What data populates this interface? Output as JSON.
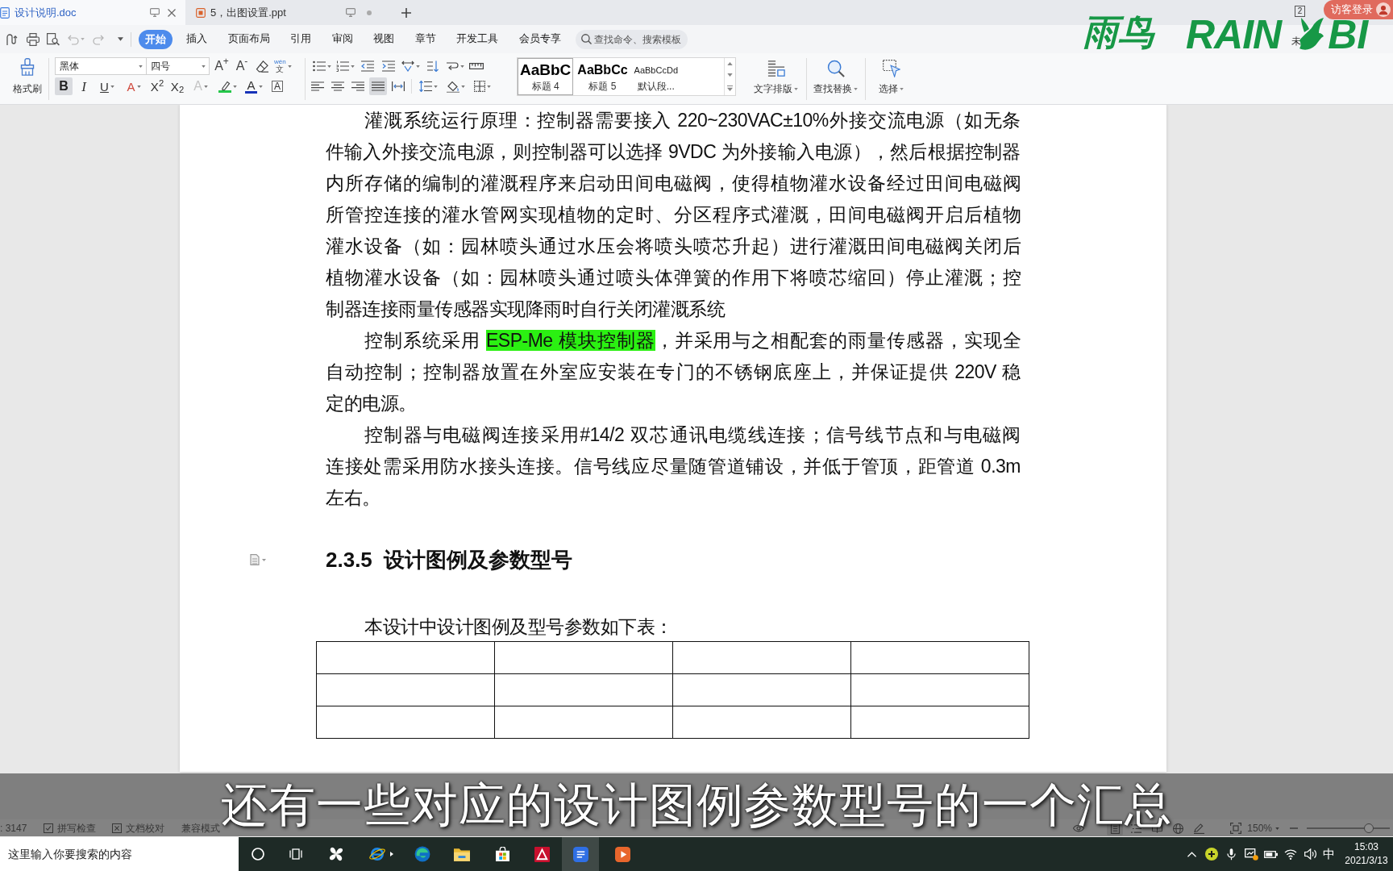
{
  "tabs": [
    {
      "label": "设计说明.doc",
      "kind": "doc",
      "selected": true
    },
    {
      "label": "5，出图设置.ppt",
      "kind": "ppt",
      "selected": false
    }
  ],
  "window_switcher": {
    "count": "2"
  },
  "login_button": {
    "label": "访客登录"
  },
  "menu_tabs": [
    {
      "label": "开始",
      "selected": true
    },
    {
      "label": "插入",
      "selected": false
    },
    {
      "label": "页面布局",
      "selected": false
    },
    {
      "label": "引用",
      "selected": false
    },
    {
      "label": "审阅",
      "selected": false
    },
    {
      "label": "视图",
      "selected": false
    },
    {
      "label": "章节",
      "selected": false
    },
    {
      "label": "开发工具",
      "selected": false
    },
    {
      "label": "会员专享",
      "selected": false
    }
  ],
  "command_search": {
    "placeholder": "查找命令、搜索模板"
  },
  "sync_status": "未",
  "toolbar": {
    "format_painter": {
      "label": "格式刷"
    },
    "font_name": "黑体",
    "font_size": "四号",
    "font_tools": [
      {
        "kind": "grow",
        "glyph": "A$^{+}$"
      },
      {
        "kind": "shrink",
        "glyph": "A$^{-}$"
      },
      {
        "kind": "clear"
      },
      {
        "kind": "pinyin",
        "glyph": "文",
        "ruby": "wén"
      }
    ],
    "format_buttons": [
      {
        "kind": "bold",
        "glyph": "B",
        "selected": true
      },
      {
        "kind": "italic",
        "glyph": "I",
        "selected": false
      },
      {
        "kind": "underline",
        "glyph": "U",
        "selected": false
      },
      {
        "kind": "strike",
        "glyph": "A",
        "selected": false
      },
      {
        "kind": "superscript",
        "glyph": "X$^{2}$",
        "selected": false
      },
      {
        "kind": "subscript",
        "glyph": "X$_{2}$",
        "selected": false
      },
      {
        "kind": "effects",
        "glyph": "A",
        "selected": false
      },
      {
        "kind": "highlight",
        "selected": false
      },
      {
        "kind": "font-color",
        "glyph": "A",
        "selected": false
      },
      {
        "kind": "char-border",
        "glyph": "A",
        "selected": false
      }
    ],
    "align_buttons": [
      {
        "kind": "left",
        "selected": false
      },
      {
        "kind": "center",
        "selected": false
      },
      {
        "kind": "right",
        "selected": false
      },
      {
        "kind": "justify",
        "selected": true
      },
      {
        "kind": "distribute",
        "selected": false
      }
    ],
    "styles": [
      {
        "kind": "heading4",
        "sample": "AaBbC",
        "label": "标题 4",
        "selected": true
      },
      {
        "kind": "heading5",
        "sample": "AaBbCc",
        "label": "标题 5",
        "selected": false
      },
      {
        "kind": "normal",
        "sample": "AaBbCcDd",
        "label": "默认段...",
        "selected": false
      }
    ],
    "large_buttons": [
      {
        "kind": "text-layout",
        "label": "文字排版"
      },
      {
        "kind": "find",
        "label": "查找替换"
      },
      {
        "kind": "select",
        "label": "选择"
      }
    ]
  },
  "document": {
    "paragraphs": [
      {
        "lines": [
          [
            {
              "kind": "plain",
              "text": "灌溉系统运行原理：控制器需要接入 220~230VAC±10%外接交流电源（如无条"
            }
          ],
          [
            {
              "kind": "plain",
              "text": "件输入外接交流电源，则控制器可以选择 9VDC 为外接输入电源），然后根据控制器"
            }
          ],
          [
            {
              "kind": "plain",
              "text": "内所存储的编制的灌溉程序来启动田间电磁阀，使得植物灌水设备经过田间电磁阀"
            }
          ],
          [
            {
              "kind": "plain",
              "text": "所管控连接的灌水管网实现植物的定时、分区程序式灌溉，田间电磁阀开启后植物"
            }
          ],
          [
            {
              "kind": "plain",
              "text": "灌水设备（如：园林喷头通过水压会将喷头喷芯升起）进行灌溉田间电磁阀关闭后"
            }
          ],
          [
            {
              "kind": "plain",
              "text": "植物灌水设备（如：园林喷头通过喷头体弹簧的作用下将喷芯缩回）停止灌溉；控"
            }
          ],
          [
            {
              "kind": "plain",
              "text": "制器连接雨量传感器实现降雨时自行关闭灌溉系统"
            }
          ]
        ]
      },
      {
        "lines": [
          [
            {
              "kind": "plain",
              "text": "控制系统采用 "
            },
            {
              "kind": "highlight",
              "text": "ESP-Me 模块控制器"
            },
            {
              "kind": "plain",
              "text": "，并采用与之相配套的雨量传感器，实现全"
            }
          ],
          [
            {
              "kind": "plain",
              "text": "自动控制；控制器放置在外室应安装在专门的不锈钢底座上，并保证提供 220V 稳"
            }
          ],
          [
            {
              "kind": "plain",
              "text": "定的电源。"
            }
          ]
        ]
      },
      {
        "lines": [
          [
            {
              "kind": "plain",
              "text": "控制器与电磁阀连接采用#14/2 双芯通讯电缆线连接；信号线节点和与电磁阀"
            }
          ],
          [
            {
              "kind": "plain",
              "text": "连接处需采用防水接头连接。信号线应尽量随管道铺设，并低于管顶，距管道 0.3m"
            }
          ],
          [
            {
              "kind": "plain",
              "text": "左右。"
            }
          ]
        ]
      }
    ],
    "heading": "2.3.5  设计图例及参数型号",
    "caption": "本设计中设计图例及型号参数如下表："
  },
  "subtitle": "还有一些对应的设计图例参数型号的一个汇总",
  "status_bar": {
    "word_count": ": 3147",
    "items": [
      {
        "kind": "spell-check",
        "label": "拼写检查"
      },
      {
        "kind": "proofread",
        "label": "文档校对"
      },
      {
        "kind": "plain",
        "label": "兼容模式"
      }
    ],
    "views": [
      {
        "kind": "page",
        "selected": true
      },
      {
        "kind": "outline",
        "selected": false
      },
      {
        "kind": "reading",
        "selected": false
      },
      {
        "kind": "web",
        "selected": false
      },
      {
        "kind": "writing",
        "selected": false
      }
    ],
    "zoom": "150%",
    "zoom_slider": {
      "level": 0.75
    }
  },
  "taskbar": {
    "search": {
      "placeholder": "这里输入你要搜索的内容"
    },
    "items": [
      {
        "kind": "cortana",
        "selected": false
      },
      {
        "kind": "task-view",
        "selected": false
      },
      {
        "kind": "pinwheel",
        "selected": false
      },
      {
        "kind": "ie",
        "selected": false
      },
      {
        "kind": "edge",
        "selected": false
      },
      {
        "kind": "explorer",
        "selected": false
      },
      {
        "kind": "store",
        "selected": false
      },
      {
        "kind": "autocad",
        "selected": false
      },
      {
        "kind": "wps-writer",
        "selected": true
      },
      {
        "kind": "wps-presentation",
        "selected": false
      }
    ],
    "input_method": "中",
    "time": "15:03",
    "date": "2021/3/13"
  },
  "overlay_logo": {
    "chinese": "雨鸟",
    "left": "RAIN",
    "right": "BI"
  }
}
